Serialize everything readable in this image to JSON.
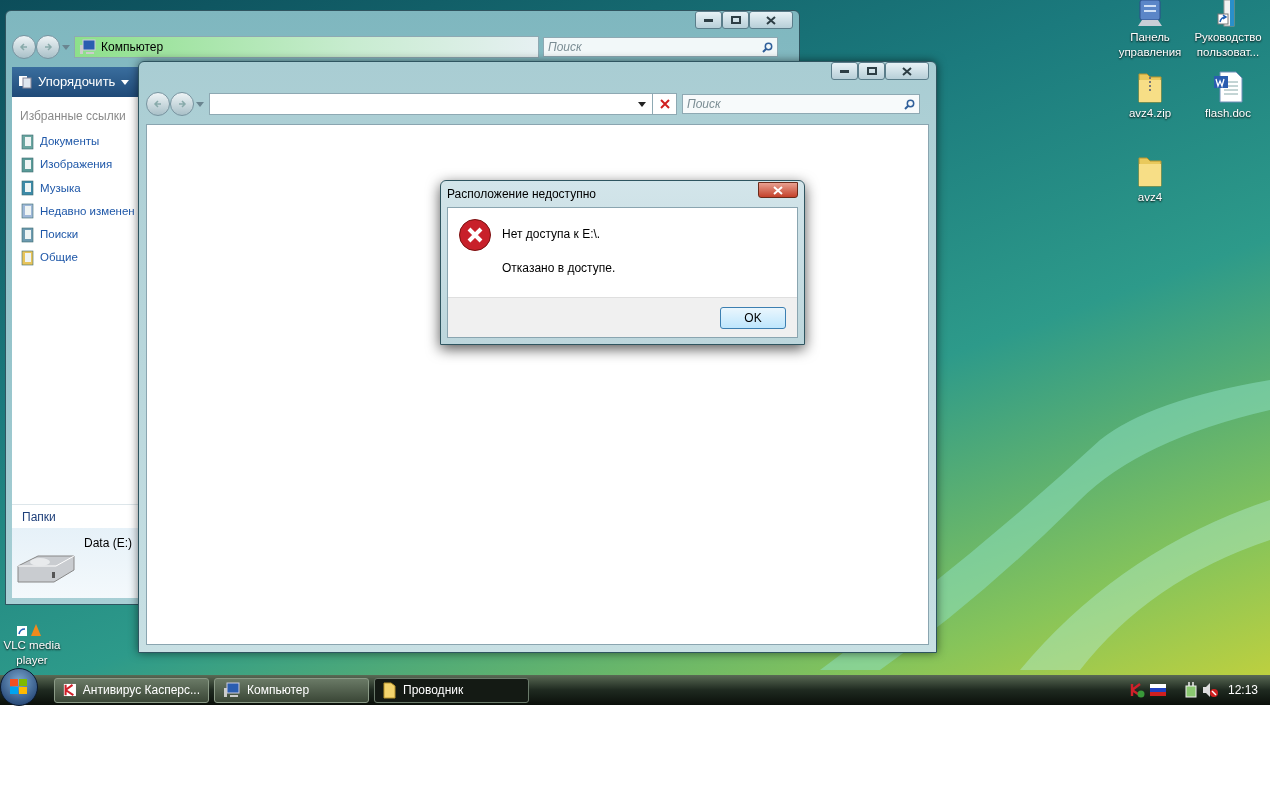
{
  "desktop_icons": [
    {
      "label": "Панель управления",
      "kind": "control-panel"
    },
    {
      "label": "Руководство пользоват...",
      "kind": "shortcut"
    },
    {
      "label": "avz4.zip",
      "kind": "zip"
    },
    {
      "label": "flash.doc",
      "kind": "doc"
    },
    {
      "label": "avz4",
      "kind": "folder"
    },
    {
      "label": "VLC media player",
      "kind": "vlc"
    }
  ],
  "back_window": {
    "address": "Компьютер",
    "search_placeholder": "Поиск",
    "toolbar_button": "Упорядочить",
    "favorites_heading": "Избранные ссылки",
    "favorites": [
      {
        "label": "Документы",
        "kind": "documents"
      },
      {
        "label": "Изображения",
        "kind": "pictures"
      },
      {
        "label": "Музыка",
        "kind": "music"
      },
      {
        "label": "Недавно изменен",
        "kind": "recent"
      },
      {
        "label": "Поиски",
        "kind": "searches"
      },
      {
        "label": "Общие",
        "kind": "folder"
      }
    ],
    "folders_label": "Папки",
    "details_name": "Data (E:)"
  },
  "front_window": {
    "search_placeholder": "Поиск"
  },
  "dialog": {
    "title": "Расположение недоступно",
    "message": "Нет доступа к E:\\.",
    "detail": "Отказано в доступе.",
    "button": "OK"
  },
  "taskbar": {
    "buttons": [
      {
        "label": "Антивирус Касперс...",
        "kind": "antivirus",
        "selected": false
      },
      {
        "label": "Компьютер",
        "kind": "computer",
        "selected": false
      },
      {
        "label": "Проводник",
        "kind": "folder",
        "selected": true
      }
    ],
    "clock": "12:13"
  }
}
